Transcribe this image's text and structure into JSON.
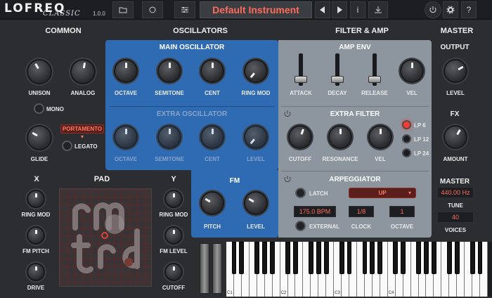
{
  "app": {
    "logo_main": "LOFREQ",
    "logo_sub": "CLASSIC",
    "version": "1.0.0",
    "preset_name": "Default Instrument"
  },
  "toolbar": {
    "folder_icon": "folder-icon",
    "circle_icon": "circle-icon",
    "sliders_icon": "sliders-icon",
    "prev_icon": "prev-icon",
    "next_icon": "next-icon",
    "info_label": "i",
    "download_icon": "download-icon",
    "power_icon": "power-icon",
    "settings_icon": "gear-icon",
    "help_label": "?"
  },
  "sections": {
    "common": "COMMON",
    "oscillators": "OSCILLATORS",
    "filter_amp": "FILTER & AMP",
    "master": "MASTER"
  },
  "common": {
    "unison": "UNISON",
    "analog": "ANALOG",
    "mono": "MONO",
    "glide": "GLIDE",
    "portamento": "PORTAMENTO",
    "legato": "LEGATO"
  },
  "main_osc": {
    "title": "MAIN OSCILLATOR",
    "knobs": [
      "OCTAVE",
      "SEMITONE",
      "CENT",
      "RING MOD"
    ]
  },
  "extra_osc": {
    "title": "EXTRA OSCILLATOR",
    "knobs": [
      "OCTAVE",
      "SEMITONE",
      "CENT",
      "LEVEL"
    ]
  },
  "fm": {
    "title": "FM",
    "knobs": [
      "PITCH",
      "LEVEL"
    ]
  },
  "amp_env": {
    "title": "AMP ENV",
    "faders": [
      "ATTACK",
      "DECAY",
      "RELEASE"
    ],
    "vel": "VEL"
  },
  "extra_filter": {
    "title": "EXTRA FILTER",
    "knobs": [
      "CUTOFF",
      "RESONANCE",
      "VEL"
    ],
    "modes": [
      "LP 6",
      "LP 12",
      "LP 24"
    ],
    "active_mode": "LP 6"
  },
  "arpeggiator": {
    "title": "ARPEGGIATOR",
    "latch": "LATCH",
    "mode": "UP",
    "bpm": "175.0 BPM",
    "clock_value": "1/8",
    "octave_value": "1",
    "external": "EXTERNAL",
    "clock": "CLOCK",
    "octave": "OCTAVE"
  },
  "master": {
    "output": "OUTPUT",
    "level": "LEVEL",
    "fx": "FX",
    "amount": "AMOUNT",
    "master_label": "MASTER",
    "tune_value": "440.00 Hz",
    "tune": "TUNE",
    "voices_value": "40",
    "voices": "VOICES"
  },
  "pad": {
    "title": "PAD",
    "x": "X",
    "y": "Y",
    "x_knobs": [
      "RING MOD",
      "FM PITCH",
      "DRIVE"
    ],
    "y_knobs": [
      "RING MOD",
      "FM LEVEL",
      "CUTOFF"
    ]
  },
  "keyboard": {
    "labels": [
      "C1",
      "C2",
      "C3",
      "C4"
    ]
  },
  "colors": {
    "accent_red": "#ff6b5a",
    "osc_blue": "#2f6bb3",
    "filter_gray": "#8d959e"
  }
}
